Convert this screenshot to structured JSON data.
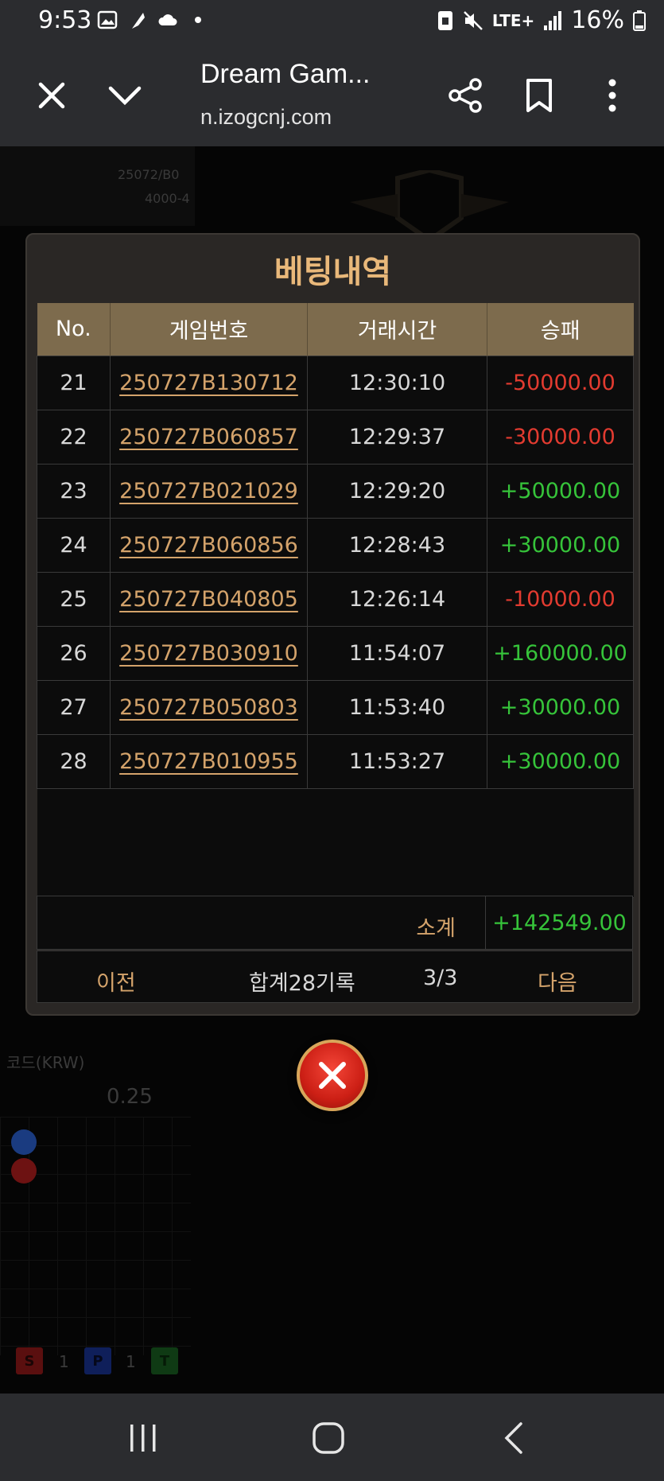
{
  "status_bar": {
    "time": "9:53",
    "network": "LTE+",
    "battery": "16%",
    "icons": [
      "image-icon",
      "feather-icon",
      "cloud-icon",
      "dot-icon",
      "sim-icon",
      "mute-icon",
      "signal-icon",
      "battery-icon"
    ]
  },
  "browser": {
    "title": "Dream Gam...",
    "url": "n.izogcnj.com",
    "buttons": [
      "close-icon",
      "chevron-down-icon",
      "share-icon",
      "bookmark-icon",
      "more-icon"
    ]
  },
  "modal": {
    "title": "베팅내역",
    "columns": [
      "No.",
      "게임번호",
      "거래시간",
      "승패"
    ],
    "rows": [
      {
        "no": "21",
        "game_id": "250727B130712",
        "time": "12:30:10",
        "result": "-50000.00",
        "status": "loss"
      },
      {
        "no": "22",
        "game_id": "250727B060857",
        "time": "12:29:37",
        "result": "-30000.00",
        "status": "loss"
      },
      {
        "no": "23",
        "game_id": "250727B021029",
        "time": "12:29:20",
        "result": "+50000.00",
        "status": "win"
      },
      {
        "no": "24",
        "game_id": "250727B060856",
        "time": "12:28:43",
        "result": "+30000.00",
        "status": "win"
      },
      {
        "no": "25",
        "game_id": "250727B040805",
        "time": "12:26:14",
        "result": "-10000.00",
        "status": "loss"
      },
      {
        "no": "26",
        "game_id": "250727B030910",
        "time": "11:54:07",
        "result": "+160000.00",
        "status": "win"
      },
      {
        "no": "27",
        "game_id": "250727B050803",
        "time": "11:53:40",
        "result": "+30000.00",
        "status": "win"
      },
      {
        "no": "28",
        "game_id": "250727B010955",
        "time": "11:53:27",
        "result": "+30000.00",
        "status": "win"
      }
    ],
    "subtotal_label": "소계",
    "subtotal_value": "+142549.00",
    "pager": {
      "prev": "이전",
      "total": "합계28기록",
      "page": "3/3",
      "next": "다음"
    }
  },
  "background": {
    "ghost_1": "25072/B0",
    "ghost_2": "4000-4",
    "ghost_3": "코드(KRW)",
    "ghost_4": "0.25",
    "counts": [
      "1",
      "1"
    ]
  },
  "colors": {
    "accent_gold": "#e9b87a",
    "header_bg": "#7d6b4d",
    "win": "#36c43a",
    "loss": "#e23b30"
  }
}
